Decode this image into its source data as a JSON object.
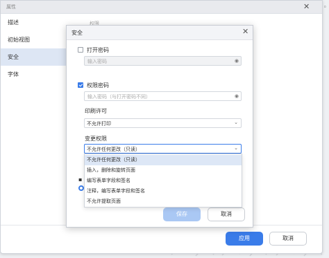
{
  "outer": {
    "title": "属性",
    "close_icon": "close-icon",
    "sidebar": [
      {
        "label": "描述",
        "active": false
      },
      {
        "label": "初始视图",
        "active": false
      },
      {
        "label": "安全",
        "active": true
      },
      {
        "label": "字体",
        "active": false
      }
    ],
    "main_hint": "权限",
    "apply_label": "应用",
    "cancel_label": "取消"
  },
  "background": {
    "caption": "[ ] [ ]"
  },
  "security": {
    "title": "安全",
    "open_password_label": "打开密码",
    "open_password_checked": false,
    "open_password_placeholder": "输入密码",
    "permission_password_label": "权限密码",
    "permission_password_checked": true,
    "permission_password_placeholder": "输入密码（与打开密码不同）",
    "print_label": "印刷许可",
    "print_value": "不允许打印",
    "change_label": "变更权限",
    "change_value": "不允许任何更改（只读）",
    "options": [
      "不允许任何更改（只读）",
      "插入，删除和旋转页面",
      "编写表单字段和签名",
      "注释，编写表单字段和签名",
      "不允许提取页面"
    ],
    "save_label": "保存",
    "cancel_label": "取消"
  },
  "colors": {
    "accent": "#3a7ce9",
    "disabled_accent": "#aac8f4",
    "selected_bg": "#dde6f4"
  }
}
